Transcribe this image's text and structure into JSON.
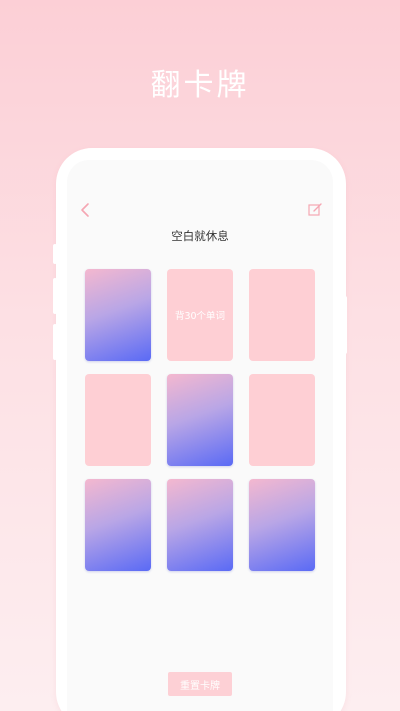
{
  "promo": {
    "title": "翻卡牌"
  },
  "header": {
    "title": "空白就休息"
  },
  "cards": [
    {
      "state": "back",
      "text": ""
    },
    {
      "state": "front",
      "text": "背30个单词"
    },
    {
      "state": "front",
      "text": ""
    },
    {
      "state": "front",
      "text": ""
    },
    {
      "state": "back",
      "text": ""
    },
    {
      "state": "front",
      "text": ""
    },
    {
      "state": "back",
      "text": ""
    },
    {
      "state": "back",
      "text": ""
    },
    {
      "state": "back",
      "text": ""
    }
  ],
  "footer": {
    "reset_label": "重置卡牌"
  },
  "icons": {
    "back": "chevron-left-icon",
    "edit": "edit-icon"
  },
  "colors": {
    "accent": "#f5a6b2",
    "card_front": "#fecfd4",
    "card_back_start": "#f4b8cf",
    "card_back_end": "#5a6af5"
  }
}
